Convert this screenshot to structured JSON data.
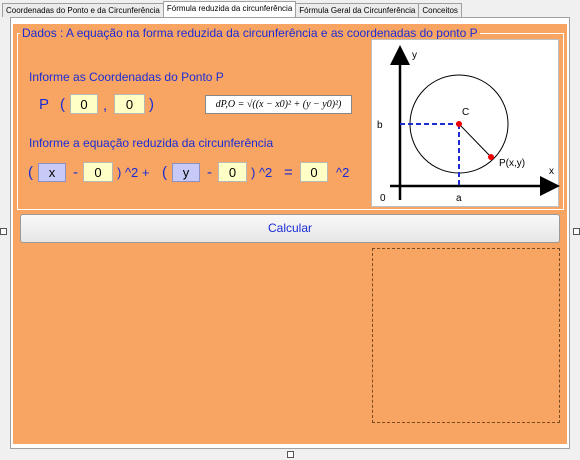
{
  "tabs": [
    {
      "label": "Coordenadas do Ponto e da Circunferência"
    },
    {
      "label": "Fórmula reduzida da circunferência"
    },
    {
      "label": "Fórmula Geral da Circunferência"
    },
    {
      "label": "Conceitos"
    }
  ],
  "active_tab_index": 1,
  "group": {
    "title": "Dados :  A equação na forma reduzida da circunferência e as coordenadas do ponto P"
  },
  "point_section": {
    "label": "Informe as Coordenadas do Ponto P",
    "point_name": "P",
    "open_paren": "(",
    "comma": ",",
    "close_paren": ")",
    "x_value": "0",
    "y_value": "0"
  },
  "formula_text": "dP,O = √((x − x0)² + (y − y0)²)",
  "equation_section": {
    "label": "Informe  a equação reduzida da circunferência",
    "paren_open": "(",
    "paren_close_pow_plus": ") ^2 +",
    "paren_close_pow": ") ^2",
    "x_var": "x",
    "y_var": "y",
    "minus": "-",
    "equals": "=",
    "pow_suffix": "^2",
    "a_value": "0",
    "b_value": "0",
    "r_value": "0"
  },
  "diagram": {
    "y_axis_label": "y",
    "x_axis_label": "x",
    "center_label": "C",
    "point_label": "P(x,y)",
    "b_label": "b",
    "a_label": "a",
    "origin_label": "0"
  },
  "calculate_button": {
    "label": "Calcular"
  },
  "colors": {
    "panel_bg": "#f8a563",
    "label_blue": "#1a2cd6",
    "input_bg": "#ffffc6",
    "var_bg": "#c7c9f6"
  }
}
